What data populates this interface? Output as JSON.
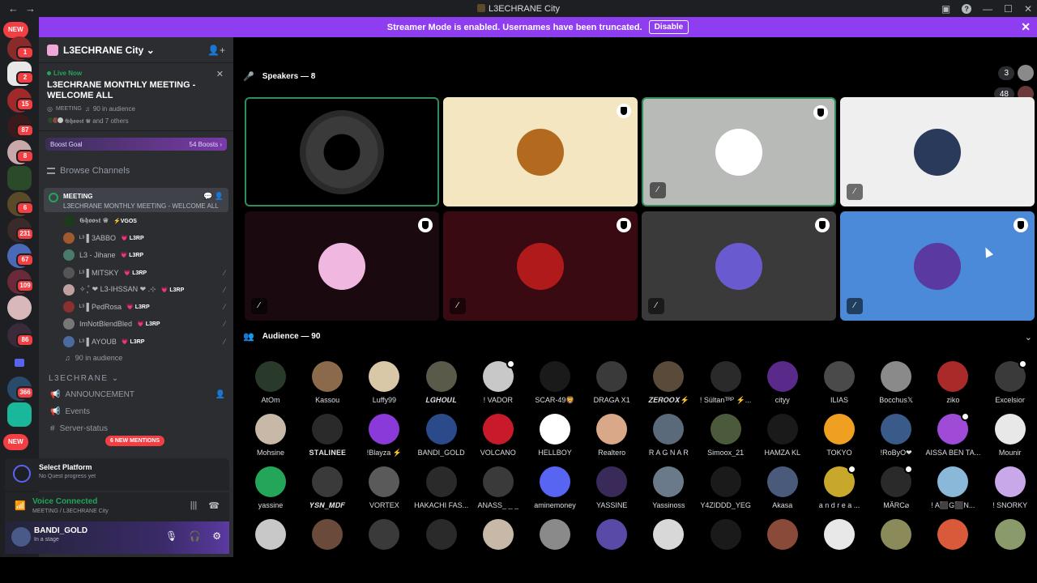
{
  "window": {
    "title": "L3ECHRANE City",
    "back": "←",
    "forward": "→",
    "minimize": "—",
    "maximize": "☐",
    "close": "✕",
    "help": "?"
  },
  "banner": {
    "text": "Streamer Mode is enabled. Usernames have been truncated.",
    "button": "Disable",
    "close": "✕"
  },
  "rail": {
    "new_top": "NEW",
    "new_bottom": "NEW",
    "badges": [
      "1",
      "2",
      "15",
      "87",
      "8",
      "6",
      "231",
      "67",
      "109",
      "86",
      "366"
    ]
  },
  "guild": {
    "name": "L3ECHRANE City",
    "chevron": "⌄"
  },
  "live": {
    "label": "Live Now",
    "title": "L3ECHRANE MONTHLY MEETING - WELCOME ALL",
    "meta_channel": "MEETING",
    "meta_audience": "90 in audience",
    "others": "𝕲𝖍𝖔𝖔𝖘𝖙 ♛ and 7 others"
  },
  "boost": {
    "label": "Boost Goal",
    "count": "54 Boosts"
  },
  "browse": "Browse Channels",
  "stage_channel": {
    "name": "MEETING",
    "topic": "L3ECHRANE MONTHLY MEETING - WELCOME ALL"
  },
  "members": [
    {
      "name": "𝕲𝖍𝖔𝖔𝖘𝖙 ♛",
      "tag": "⚡VGOS",
      "color": "#1c3a1c"
    },
    {
      "name": "ᴸ³ ▌3ABBO",
      "tag": "💗 L3RP",
      "color": "#a05a30"
    },
    {
      "name": "L3 - Jihane",
      "tag": "💗 L3RP",
      "color": "#4a7a6a"
    },
    {
      "name": "ᴸ³ ▌MITSKY",
      "tag": "💗 L3RP",
      "color": "#555"
    },
    {
      "name": "✧ ̥˚ ❤ L3-IHSSAN ❤ .⊹",
      "tag": "💗 L3RP",
      "color": "#c0a0a0"
    },
    {
      "name": "ᴸ³ ▌PedRosa",
      "tag": "💗 L3RP",
      "color": "#8a3030"
    },
    {
      "name": "ImNotBlendBled",
      "tag": "💗 L3RP",
      "color": "#777"
    },
    {
      "name": "ᴸ³ ▌AYOUB",
      "tag": "💗 L3RP",
      "color": "#4a6aa0"
    }
  ],
  "audience_line": "90 in audience",
  "category": "L3ECHRANE",
  "channels": [
    {
      "name": "ANNOUNCEMENT"
    },
    {
      "name": "Events"
    },
    {
      "name": "Server-status"
    }
  ],
  "mentions": "6 NEW MENTIONS",
  "quest": {
    "title": "Select Platform",
    "subtitle": "No Quest progress yet"
  },
  "voice": {
    "status": "Voice Connected",
    "location": "MEETING / L3ECHRANE City"
  },
  "user": {
    "name": "BANDI_GOLD",
    "status": "In a stage"
  },
  "speakers_header": "Speakers — 8",
  "audience_header": "Audience — 90",
  "count_badges": [
    "3",
    "48",
    "48"
  ],
  "speaker_tiles": [
    {
      "bg": "#000000",
      "face": "#1a1a1a",
      "border": "#2f8f5a",
      "shield": false,
      "muted": false
    },
    {
      "bg": "#f3e6c1",
      "face": "#b46a1e",
      "border": "",
      "shield": true,
      "muted": false
    },
    {
      "bg": "#b8bab8",
      "face": "#ffffff",
      "border": "#2f8f5a",
      "shield": true,
      "muted": true
    },
    {
      "bg": "#efefef",
      "face": "#2a3a5a",
      "border": "",
      "shield": false,
      "muted": true
    },
    {
      "bg": "#1a0a10",
      "face": "#f0b8e0",
      "border": "",
      "shield": true,
      "muted": true
    },
    {
      "bg": "#3a0a12",
      "face": "#b01a1a",
      "border": "",
      "shield": true,
      "muted": true
    },
    {
      "bg": "#3a3a3a",
      "face": "#6a5ad0",
      "border": "",
      "shield": true,
      "muted": true
    },
    {
      "bg": "#4a8ad8",
      "face": "#5a3aa0",
      "border": "",
      "shield": true,
      "muted": true
    }
  ],
  "audience": [
    {
      "name": "AtOm",
      "color": "#2a3a2a"
    },
    {
      "name": "Kassou",
      "color": "#8a6a4a"
    },
    {
      "name": "Luffy99",
      "color": "#d8c8a8"
    },
    {
      "name": "𝑳𝑮𝑯𝑶𝑼𝑳",
      "color": "#5a5a4a"
    },
    {
      "name": "! VADOR",
      "color": "#c8c8c8"
    },
    {
      "name": "SCAR-49🦁",
      "color": "#1a1a1a"
    },
    {
      "name": "DRAGA X1",
      "color": "#3a3a3a"
    },
    {
      "name": "𝒁𝑬𝑹𝑶𝑶𝑿⚡️",
      "color": "#5a4a3a"
    },
    {
      "name": "! Sültanᵀᴿᴾ ⚡...",
      "color": "#2a2a2a"
    },
    {
      "name": "cityy",
      "color": "#5a2a8a"
    },
    {
      "name": "ILIAS",
      "color": "#4a4a4a"
    },
    {
      "name": "Bocchus𝕏",
      "color": "#8a8a8a"
    },
    {
      "name": "ziko",
      "color": "#aa2a2a"
    },
    {
      "name": "Excelsior",
      "color": "#3a3a3a"
    },
    {
      "name": "Mohsine",
      "color": "#c8b8a8"
    },
    {
      "name": "𝐒𝐓𝐀𝐋𝐈𝐍𝐄𝐄",
      "color": "#2a2a2a"
    },
    {
      "name": "!Blayza ⚡",
      "color": "#8a3ad8"
    },
    {
      "name": "BANDI_GOLD",
      "color": "#2a4a8a"
    },
    {
      "name": "VOLCANO",
      "color": "#c81a2a"
    },
    {
      "name": "HELLBOY",
      "color": "#ffffff"
    },
    {
      "name": "Realtero",
      "color": "#d8a888"
    },
    {
      "name": "R A G N A R",
      "color": "#5a6a7a"
    },
    {
      "name": "Simoox_21",
      "color": "#4a5a3a"
    },
    {
      "name": "HAMZA KL",
      "color": "#1a1a1a"
    },
    {
      "name": "TOKYO",
      "color": "#f0a020"
    },
    {
      "name": "!RoByO❤",
      "color": "#3a5a8a"
    },
    {
      "name": "AISSA BEN TA...",
      "color": "#a04ad8"
    },
    {
      "name": "Mounir",
      "color": "#e8e8e8"
    },
    {
      "name": "yassine",
      "color": "#23a55a"
    },
    {
      "name": "𝒀𝑺𝑵_𝑴𝑫𝑭",
      "color": "#3a3a3a"
    },
    {
      "name": "VORTEX",
      "color": "#5a5a5a"
    },
    {
      "name": "HAKACHI FAS...",
      "color": "#2a2a2a"
    },
    {
      "name": "ANASS_ _ _",
      "color": "#3a3a3a"
    },
    {
      "name": "aminemoney",
      "color": "#5865f2"
    },
    {
      "name": "YASSINE",
      "color": "#3a2a5a"
    },
    {
      "name": "Yassinoss",
      "color": "#6a7a8a"
    },
    {
      "name": "Y4ZIDDD_YEG",
      "color": "#1a1a1a"
    },
    {
      "name": "Akasa",
      "color": "#4a5a7a"
    },
    {
      "name": "a n d r e a ...",
      "color": "#c8a82a"
    },
    {
      "name": "MÄRC⌀",
      "color": "#2a2a2a"
    },
    {
      "name": "! A⬛G⬛N...",
      "color": "#8ab8d8"
    },
    {
      "name": "! SNORKY",
      "color": "#c8a8e8"
    },
    {
      "name": "",
      "color": "#c8c8c8"
    },
    {
      "name": "",
      "color": "#6a4a3a"
    },
    {
      "name": "",
      "color": "#3a3a3a"
    },
    {
      "name": "",
      "color": "#2a2a2a"
    },
    {
      "name": "",
      "color": "#c8b8a8"
    },
    {
      "name": "",
      "color": "#8a8a8a"
    },
    {
      "name": "",
      "color": "#5a4aa8"
    },
    {
      "name": "",
      "color": "#d8d8d8"
    },
    {
      "name": "",
      "color": "#1a1a1a"
    },
    {
      "name": "",
      "color": "#8a4a3a"
    },
    {
      "name": "",
      "color": "#e8e8e8"
    },
    {
      "name": "",
      "color": "#8a8a5a"
    },
    {
      "name": "",
      "color": "#d85a3a"
    },
    {
      "name": "",
      "color": "#8a9a6a"
    }
  ]
}
